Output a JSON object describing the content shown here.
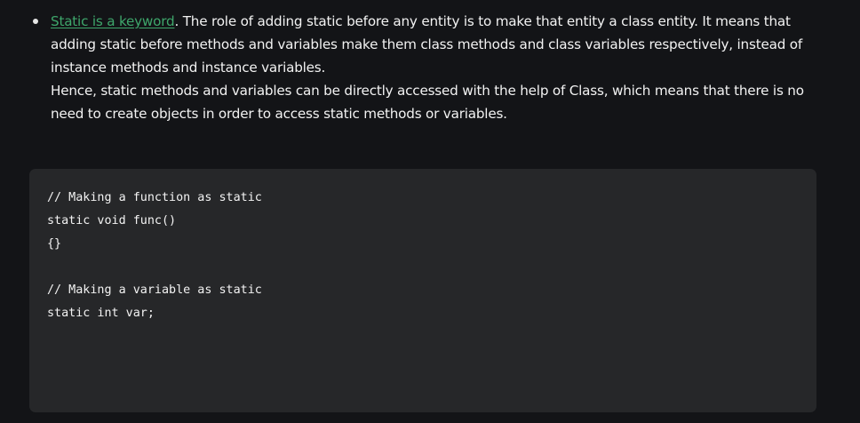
{
  "article": {
    "item": {
      "link_text": "Static is a keyword",
      "text_1": ". The role of adding static before any entity is to make that entity a class entity. It means that adding static before methods and variables make them class methods and class variables respectively, instead of instance methods and instance variables.",
      "text_2": "Hence, static methods and variables can be directly accessed with the help of Class, which means that there is no need to create objects in order to access static methods or variables."
    },
    "code": {
      "lines": [
        "// Making a function as static",
        "static void func()",
        "{}",
        "",
        "// Making a variable as static",
        "static int var;"
      ]
    }
  }
}
